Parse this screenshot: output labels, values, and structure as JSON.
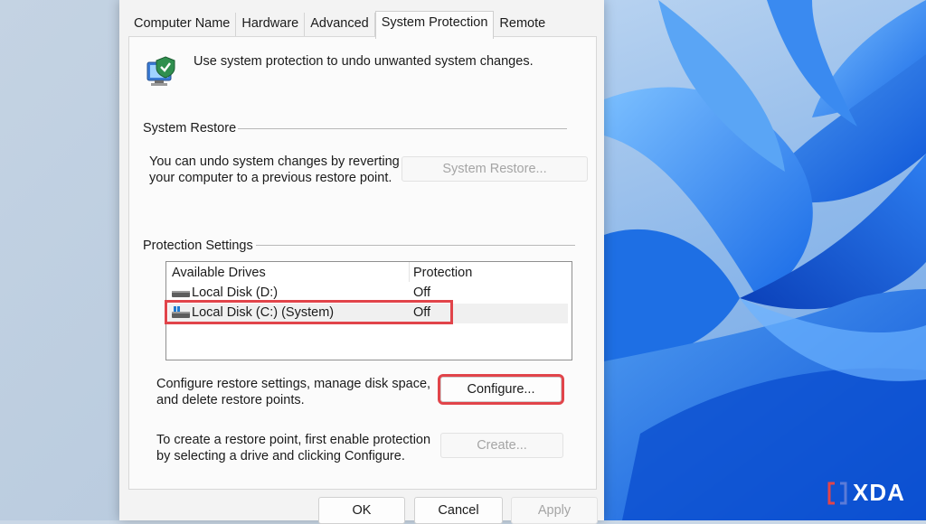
{
  "tabs": [
    {
      "label": "Computer Name"
    },
    {
      "label": "Hardware"
    },
    {
      "label": "Advanced"
    },
    {
      "label": "System Protection",
      "active": true
    },
    {
      "label": "Remote"
    }
  ],
  "header": {
    "description": "Use system protection to undo unwanted system changes.",
    "icon": "system-protection-icon"
  },
  "system_restore": {
    "group_label": "System Restore",
    "description_line1": "You can undo system changes by reverting",
    "description_line2": "your computer to a previous restore point.",
    "button_label": "System Restore..."
  },
  "protection_settings": {
    "group_label": "Protection Settings",
    "columns": [
      "Available Drives",
      "Protection"
    ],
    "drives": [
      {
        "name": "Local Disk (D:)",
        "protection": "Off",
        "icon": "drive-icon"
      },
      {
        "name": "Local Disk (C:) (System)",
        "protection": "Off",
        "icon": "system-drive-icon",
        "selected": true
      }
    ],
    "configure_text_line1": "Configure restore settings, manage disk space,",
    "configure_text_line2": "and delete restore points.",
    "configure_button": "Configure...",
    "create_text_line1": "To create a restore point, first enable protection",
    "create_text_line2": "by selecting a drive and clicking Configure.",
    "create_button": "Create..."
  },
  "footer": {
    "ok": "OK",
    "cancel": "Cancel",
    "apply": "Apply"
  },
  "watermark": {
    "text": "XDA"
  },
  "colors": {
    "highlight": "#e1444a",
    "accent": "#1f6fd1",
    "dialog_bg": "#f3f3f3"
  }
}
